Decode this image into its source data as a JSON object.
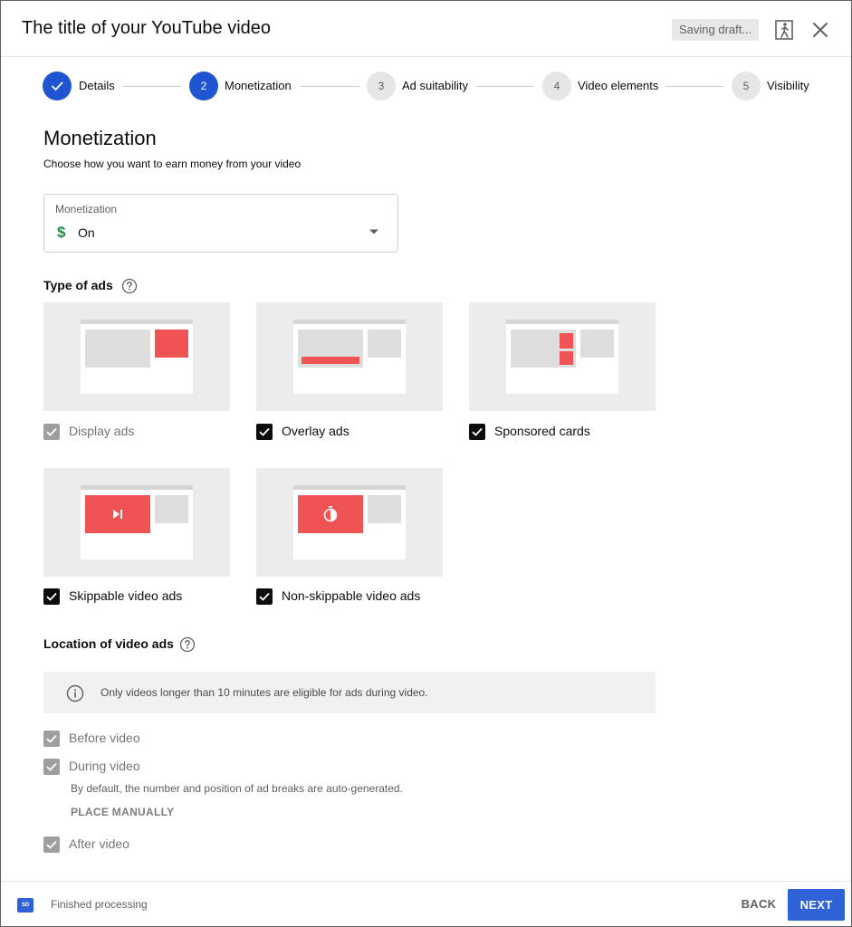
{
  "header": {
    "title": "The title of your YouTube video",
    "saving_status": "Saving draft..."
  },
  "stepper": {
    "steps": [
      {
        "number": "",
        "label": "Details",
        "state": "done"
      },
      {
        "number": "2",
        "label": "Monetization",
        "state": "active"
      },
      {
        "number": "3",
        "label": "Ad suitability",
        "state": "todo"
      },
      {
        "number": "4",
        "label": "Video elements",
        "state": "todo"
      },
      {
        "number": "5",
        "label": "Visibility",
        "state": "todo"
      }
    ]
  },
  "monetization": {
    "heading": "Monetization",
    "subtitle": "Choose how you want to earn money from your video",
    "select_label": "Monetization",
    "select_symbol": "$",
    "select_value": "On"
  },
  "ad_types": {
    "title": "Type of ads",
    "items": [
      {
        "label": "Display ads",
        "checked": true,
        "disabled": true
      },
      {
        "label": "Overlay ads",
        "checked": true,
        "disabled": false
      },
      {
        "label": "Sponsored cards",
        "checked": true,
        "disabled": false
      },
      {
        "label": "Skippable video ads",
        "checked": true,
        "disabled": false
      },
      {
        "label": "Non-skippable video ads",
        "checked": true,
        "disabled": false
      }
    ]
  },
  "location": {
    "title": "Location of video ads",
    "info": "Only videos longer than 10 minutes are eligible for ads during video.",
    "options": [
      {
        "label": "Before video",
        "checked": true,
        "disabled": true
      },
      {
        "label": "During video",
        "checked": true,
        "disabled": true
      },
      {
        "label": "After video",
        "checked": true,
        "disabled": true
      }
    ],
    "note": "By default, the number and position of ad breaks are auto-generated.",
    "place_manually": "PLACE MANUALLY"
  },
  "footer": {
    "quality_badge": "SD",
    "status": "Finished processing",
    "back_label": "BACK",
    "next_label": "NEXT"
  },
  "colors": {
    "accent": "#2e62d6",
    "ad_red": "#ef5353",
    "money_green": "#1e8e3e"
  }
}
